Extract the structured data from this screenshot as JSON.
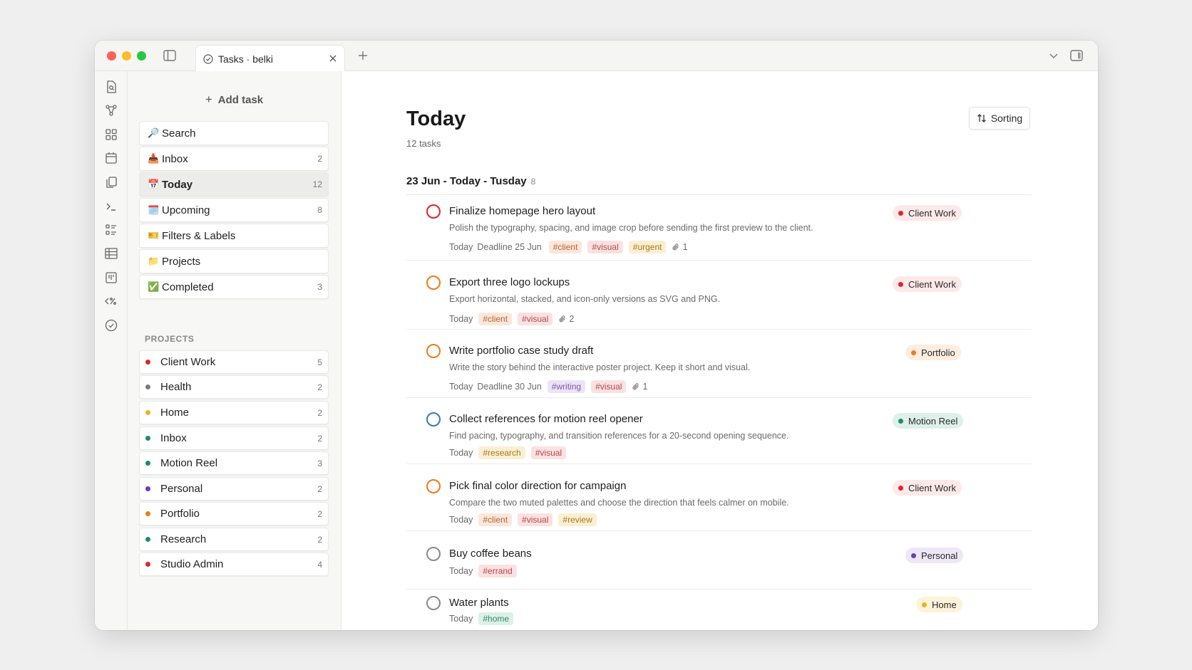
{
  "window": {
    "tab_title": "Tasks · belki"
  },
  "sidebar": {
    "add_task_label": "Add task",
    "nav": [
      {
        "emoji": "🔎",
        "label": "Search",
        "count": ""
      },
      {
        "emoji": "📥",
        "label": "Inbox",
        "count": "2"
      },
      {
        "emoji": "📅",
        "label": "Today",
        "count": "12"
      },
      {
        "emoji": "🗓️",
        "label": "Upcoming",
        "count": "8"
      },
      {
        "emoji": "🎫",
        "label": "Filters & Labels",
        "count": ""
      },
      {
        "emoji": "📁",
        "label": "Projects",
        "count": ""
      },
      {
        "emoji": "✅",
        "label": "Completed",
        "count": "3"
      }
    ],
    "projects_heading": "PROJECTS",
    "projects": [
      {
        "label": "Client Work",
        "count": "5",
        "color": "#e0242b"
      },
      {
        "label": "Health",
        "count": "2",
        "color": "#7a7a7a"
      },
      {
        "label": "Home",
        "count": "2",
        "color": "#f0b01c"
      },
      {
        "label": "Inbox",
        "count": "2",
        "color": "#1f8a6e"
      },
      {
        "label": "Motion Reel",
        "count": "3",
        "color": "#1f8a6e"
      },
      {
        "label": "Personal",
        "count": "2",
        "color": "#6b3fb0"
      },
      {
        "label": "Portfolio",
        "count": "2",
        "color": "#ee7a1a"
      },
      {
        "label": "Research",
        "count": "2",
        "color": "#1f8a6e"
      },
      {
        "label": "Studio Admin",
        "count": "4",
        "color": "#e0242b"
      }
    ]
  },
  "main": {
    "title": "Today",
    "task_count": "12 tasks",
    "sort_label": "Sorting",
    "group": {
      "label": "23 Jun - Today - Tusday",
      "count": "8"
    },
    "tasks": [
      {
        "title": "Finalize homepage hero layout",
        "description": "Polish the typography, spacing, and image crop before sending the first preview to the client.",
        "meta": [
          "Today",
          "Deadline 25 Jun"
        ],
        "tags": [
          "#client",
          "#visual",
          "#urgent"
        ],
        "attachments": "1",
        "project": "Client Work",
        "circle_color": "#e0242b"
      },
      {
        "title": "Export three logo lockups",
        "description": "Export horizontal, stacked, and icon-only versions as SVG and PNG.",
        "meta": [
          "Today"
        ],
        "tags": [
          "#client",
          "#visual"
        ],
        "attachments": "2",
        "project": "Client Work",
        "circle_color": "#ee7a1a"
      },
      {
        "title": "Write portfolio case study draft",
        "description": "Write the story behind the interactive poster project. Keep it short and visual.",
        "meta": [
          "Today",
          "Deadline 30 Jun"
        ],
        "tags": [
          "#writing",
          "#visual"
        ],
        "attachments": "1",
        "project": "Portfolio",
        "circle_color": "#ee7a1a"
      },
      {
        "title": "Collect references for motion reel opener",
        "description": "Find pacing, typography, and transition references for a 20-second opening sequence.",
        "meta": [
          "Today"
        ],
        "tags": [
          "#research",
          "#visual"
        ],
        "attachments": "",
        "project": "Motion Reel",
        "circle_color": "#2f7fb5"
      },
      {
        "title": "Pick final color direction for campaign",
        "description": "Compare the two muted palettes and choose the direction that feels calmer on mobile.",
        "meta": [
          "Today"
        ],
        "tags": [
          "#client",
          "#visual",
          "#review"
        ],
        "attachments": "",
        "project": "Client Work",
        "circle_color": "#ee7a1a"
      },
      {
        "title": "Buy coffee beans",
        "description": "",
        "meta": [
          "Today"
        ],
        "tags": [
          "#errand"
        ],
        "attachments": "",
        "project": "Personal",
        "circle_color": "#8a8a8a"
      },
      {
        "title": "Water plants",
        "description": "",
        "meta": [
          "Today"
        ],
        "tags": [
          "#home"
        ],
        "attachments": "",
        "project": "Home",
        "circle_color": "#8a8a8a"
      }
    ]
  },
  "colors": {
    "tag_styles": {
      "#client": {
        "bg": "#fbe7dc",
        "fg": "#b5652f"
      },
      "#visual": {
        "bg": "#fbe1e1",
        "fg": "#b5474a"
      },
      "#urgent": {
        "bg": "#fbefd3",
        "fg": "#a9781d"
      },
      "#writing": {
        "bg": "#ede3f6",
        "fg": "#7d58a8"
      },
      "#research": {
        "bg": "#fbefd3",
        "fg": "#a9781d"
      },
      "#review": {
        "bg": "#fbefd3",
        "fg": "#a9781d"
      },
      "#errand": {
        "bg": "#fbe1e1",
        "fg": "#b5474a"
      },
      "#home": {
        "bg": "#dcf0e8",
        "fg": "#2f8a6a"
      }
    },
    "badge_styles": {
      "Client Work": {
        "bg": "#fde9e8",
        "fg": "#2a2a2a",
        "dot": "#e0242b"
      },
      "Portfolio": {
        "bg": "#fdeedf",
        "fg": "#2a2a2a",
        "dot": "#ee7a1a"
      },
      "Motion Reel": {
        "bg": "#ddf0ea",
        "fg": "#2a2a2a",
        "dot": "#1f8a6e"
      },
      "Personal": {
        "bg": "#ede7f6",
        "fg": "#2a2a2a",
        "dot": "#6b3fb0"
      },
      "Home": {
        "bg": "#fdf3d8",
        "fg": "#2a2a2a",
        "dot": "#f0b01c"
      }
    }
  }
}
